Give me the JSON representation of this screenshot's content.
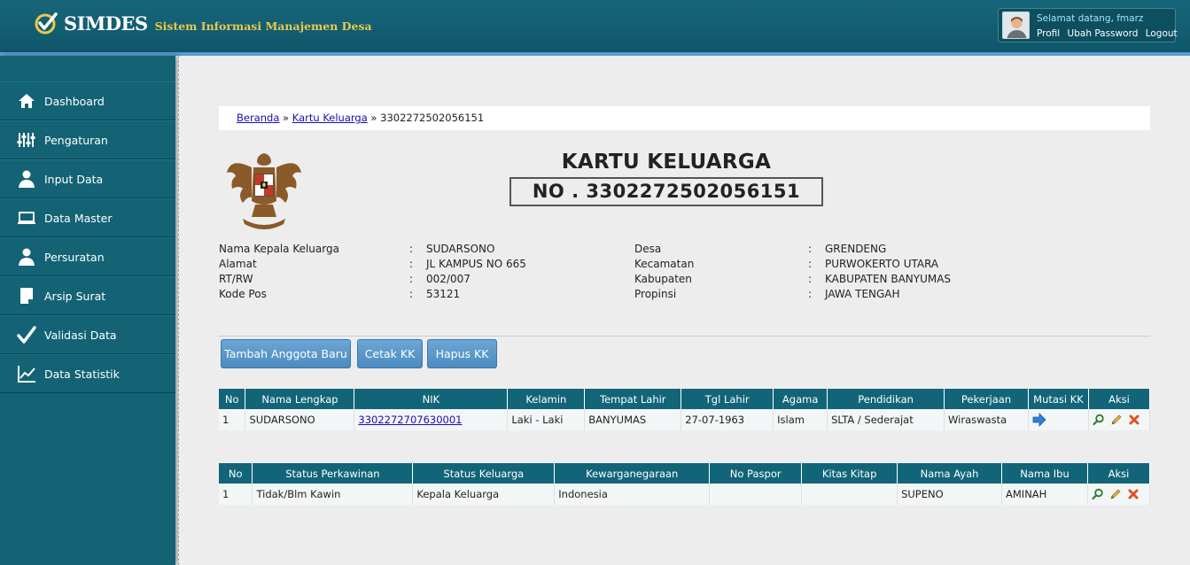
{
  "header": {
    "app_name": "SIMDES",
    "app_subtitle": "Sistem Informasi Manajemen Desa",
    "greeting": "Selamat datang, fmarz",
    "links": [
      "Profil",
      "Ubah Password",
      "Logout"
    ]
  },
  "sidebar": {
    "items": [
      {
        "label": "Dashboard",
        "icon": "home-icon"
      },
      {
        "label": "Pengaturan",
        "icon": "sliders-icon"
      },
      {
        "label": "Input Data",
        "icon": "user-icon"
      },
      {
        "label": "Data Master",
        "icon": "laptop-icon"
      },
      {
        "label": "Persuratan",
        "icon": "user-icon"
      },
      {
        "label": "Arsip Surat",
        "icon": "document-icon"
      },
      {
        "label": "Validasi Data",
        "icon": "check-icon"
      },
      {
        "label": "Data Statistik",
        "icon": "line-chart-icon"
      }
    ]
  },
  "breadcrumb": {
    "items": [
      "Beranda",
      "Kartu Keluarga"
    ],
    "separator": "»",
    "current": "3302272502056151"
  },
  "kk": {
    "title": "KARTU KELUARGA",
    "number": "NO . 3302272502056151"
  },
  "info": {
    "left": [
      {
        "label": "Nama Kepala Keluarga",
        "value": "SUDARSONO"
      },
      {
        "label": "Alamat",
        "value": "JL KAMPUS NO 665"
      },
      {
        "label": "RT/RW",
        "value": "002/007"
      },
      {
        "label": "Kode Pos",
        "value": "53121"
      }
    ],
    "right": [
      {
        "label": "Desa",
        "value": "GRENDENG"
      },
      {
        "label": "Kecamatan",
        "value": "PURWOKERTO UTARA"
      },
      {
        "label": "Kabupaten",
        "value": "KABUPATEN BANYUMAS"
      },
      {
        "label": "Propinsi",
        "value": "JAWA TENGAH"
      }
    ]
  },
  "buttons": {
    "tambah": "Tambah Anggota Baru",
    "cetak": "Cetak KK",
    "hapus": "Hapus KK"
  },
  "table1": {
    "headers": [
      "No",
      "Nama Lengkap",
      "NIK",
      "Kelamin",
      "Tempat Lahir",
      "Tgl Lahir",
      "Agama",
      "Pendidikan",
      "Pekerjaan",
      "Mutasi KK",
      "Aksi"
    ],
    "rows": [
      {
        "no": "1",
        "nama": "SUDARSONO",
        "nik": "3302272707630001",
        "kelamin": "Laki - Laki",
        "tempat_lahir": "BANYUMAS",
        "tgl_lahir": "27-07-1963",
        "agama": "Islam",
        "pendidikan": "SLTA / Sederajat",
        "pekerjaan": "Wiraswasta"
      }
    ]
  },
  "table2": {
    "headers": [
      "No",
      "Status Perkawinan",
      "Status Keluarga",
      "Kewarganegaraan",
      "No Paspor",
      "Kitas Kitap",
      "Nama Ayah",
      "Nama Ibu",
      "Aksi"
    ],
    "rows": [
      {
        "no": "1",
        "status_perkawinan": "Tidak/Blm Kawin",
        "status_keluarga": "Kepala Keluarga",
        "kewarganegaraan": "Indonesia",
        "no_paspor": "",
        "kitas_kitap": "",
        "nama_ayah": "SUPENO",
        "nama_ibu": "AMINAH"
      }
    ]
  },
  "colors": {
    "header": "#17657a",
    "sidebar": "#136374",
    "table_header": "#126578",
    "button": "#5a97cc",
    "accent_yellow": "#e9c94b"
  }
}
